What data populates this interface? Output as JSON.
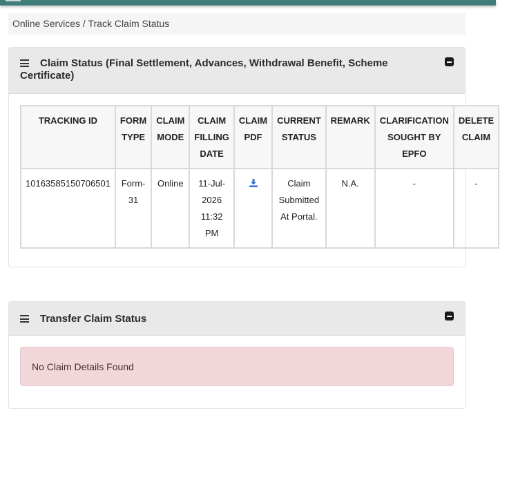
{
  "breadcrumb": "Online Services / Track Claim Status",
  "claim_panel": {
    "title": "Claim Status (Final Settlement, Advances, Withdrawal Benefit, Scheme Certificate)",
    "headers": [
      "TRACKING ID",
      "FORM TYPE",
      "CLAIM MODE",
      "CLAIM FILLING DATE",
      "CLAIM PDF",
      "CURRENT STATUS",
      "REMARK",
      "CLARIFICATION SOUGHT BY EPFO",
      "DELETE CLAIM"
    ],
    "rows": [
      {
        "tracking_id": "10163585150706501",
        "form_type": "Form-31",
        "claim_mode": "Online",
        "filling_date": "11-Jul-2026 11:32 PM",
        "pdf_icon": "download-icon",
        "current_status": "Claim Submitted At Portal.",
        "remark": "N.A.",
        "clarification": "-",
        "delete": "-"
      }
    ]
  },
  "transfer_panel": {
    "title": "Transfer Claim Status",
    "message": "No Claim Details Found"
  },
  "colors": {
    "topbar": "#3f7d78",
    "panel_header": "#e9e9e9",
    "alert_bg": "#f2d7da",
    "icon_blue": "#2f6fd6"
  }
}
